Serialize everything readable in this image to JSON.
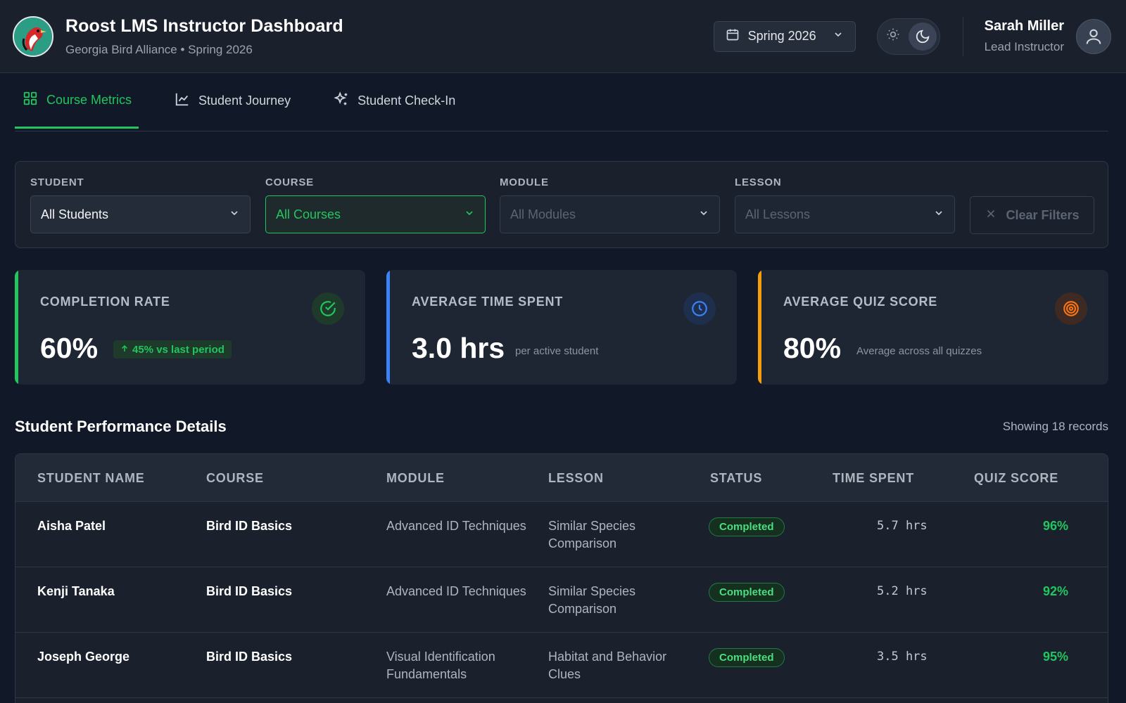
{
  "header": {
    "title": "Roost LMS Instructor Dashboard",
    "subtitle": "Georgia Bird Alliance • Spring 2026",
    "term": "Spring 2026",
    "user": {
      "name": "Sarah Miller",
      "role": "Lead Instructor"
    }
  },
  "tabs": [
    {
      "label": "Course Metrics",
      "icon": "grid-icon",
      "active": true
    },
    {
      "label": "Student Journey",
      "icon": "line-chart-icon",
      "active": false
    },
    {
      "label": "Student Check-In",
      "icon": "sparkles-icon",
      "active": false
    }
  ],
  "filters": {
    "student": {
      "label": "STUDENT",
      "value": "All Students"
    },
    "course": {
      "label": "COURSE",
      "value": "All Courses"
    },
    "module": {
      "label": "MODULE",
      "value": "All Modules"
    },
    "lesson": {
      "label": "LESSON",
      "value": "All Lessons"
    },
    "clear": "Clear Filters"
  },
  "metrics": {
    "completion": {
      "label": "COMPLETION RATE",
      "value": "60%",
      "trend": "45% vs last period",
      "color": "#22c55e"
    },
    "time": {
      "label": "AVERAGE TIME SPENT",
      "value": "3.0 hrs",
      "sub": "per active student",
      "color": "#3b82f6"
    },
    "quiz": {
      "label": "AVERAGE QUIZ SCORE",
      "value": "80%",
      "sub": "Average across all quizzes",
      "color": "#f59e0b"
    }
  },
  "section": {
    "title": "Student Performance Details",
    "count": "Showing 18 records"
  },
  "table": {
    "headers": {
      "name": "STUDENT NAME",
      "course": "COURSE",
      "module": "MODULE",
      "lesson": "LESSON",
      "status": "STATUS",
      "time": "TIME SPENT",
      "score": "QUIZ SCORE"
    },
    "rows": [
      {
        "name": "Aisha Patel",
        "course": "Bird ID Basics",
        "module": "Advanced ID Techniques",
        "lesson": "Similar Species Comparison",
        "status": "Completed",
        "time": "5.7 hrs",
        "score": "96%"
      },
      {
        "name": "Kenji Tanaka",
        "course": "Bird ID Basics",
        "module": "Advanced ID Techniques",
        "lesson": "Similar Species Comparison",
        "status": "Completed",
        "time": "5.2 hrs",
        "score": "92%"
      },
      {
        "name": "Joseph George",
        "course": "Bird ID Basics",
        "module": "Visual Identification Fundamentals",
        "lesson": "Habitat and Behavior Clues",
        "status": "Completed",
        "time": "3.5 hrs",
        "score": "95%"
      }
    ]
  }
}
